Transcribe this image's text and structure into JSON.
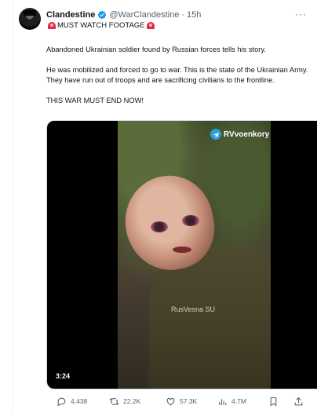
{
  "tweet": {
    "display_name": "Clandestine",
    "handle": "@WarClandestine",
    "separator": "·",
    "time": "15h",
    "more_label": "···",
    "headline": "MUST WATCH FOOTAGE",
    "paragraphs": [
      "Abandoned Ukrainian soldier found by Russian forces tells his story.",
      "He was mobilized and forced to go to war. This is the state of the Ukrainian Army. They have run out of troops and are sacrificing civilians to the frontline.",
      "THIS WAR MUST END NOW!"
    ]
  },
  "media": {
    "watermark_top": "RVvoenkory",
    "watermark_mid": "RusVesna SU",
    "duration": "3:24"
  },
  "actions": {
    "replies": "4,438",
    "reposts": "22.2K",
    "likes": "57.3K",
    "views": "4.7M"
  },
  "colors": {
    "accent": "#1d9bf0",
    "muted": "#536471",
    "text": "#0f1419",
    "siren": "#e0245e"
  },
  "icons": [
    "verified-badge-icon",
    "more-icon",
    "siren-icon",
    "telegram-icon",
    "reply-icon",
    "repost-icon",
    "like-icon",
    "views-icon",
    "bookmark-icon",
    "share-icon"
  ]
}
